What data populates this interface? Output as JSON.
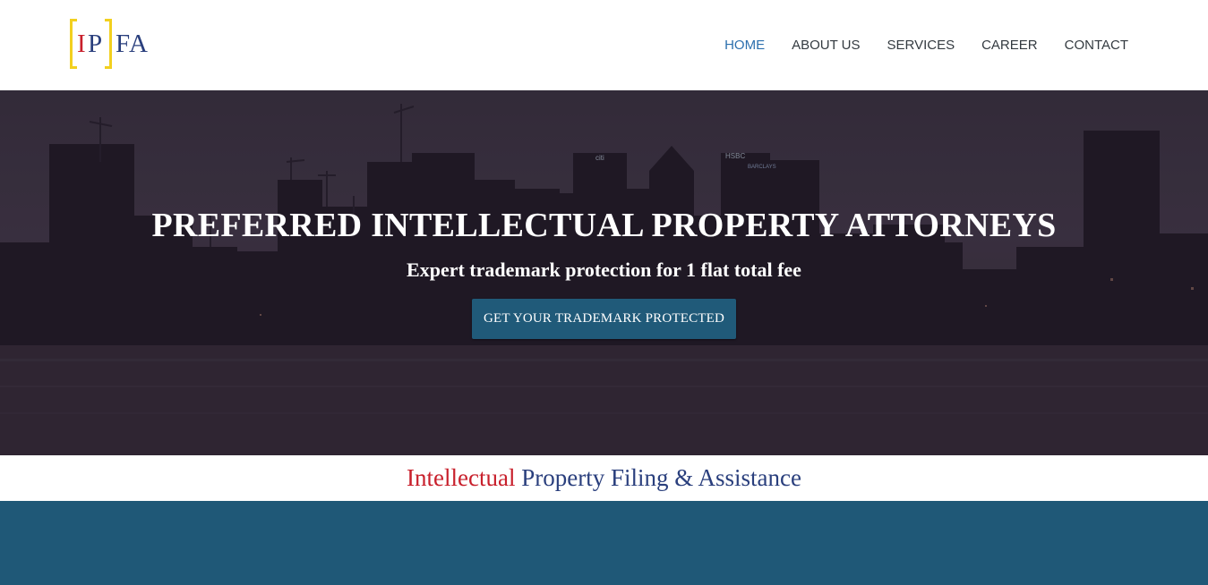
{
  "logo": {
    "letter_i": "I",
    "letter_p": "P",
    "letters_fa": "FA"
  },
  "nav": {
    "items": [
      {
        "label": "HOME",
        "active": true
      },
      {
        "label": "ABOUT US",
        "active": false
      },
      {
        "label": "SERVICES",
        "active": false
      },
      {
        "label": "CAREER",
        "active": false
      },
      {
        "label": "CONTACT",
        "active": false
      }
    ]
  },
  "hero": {
    "title": "PREFERRED INTELLECTUAL PROPERTY ATTORNEYS",
    "subtitle": "Expert trademark protection for 1 flat total fee",
    "cta_label": "GET YOUR TRADEMARK PROTECTED",
    "sign_hsbc": "HSBC",
    "sign_citi": "citi",
    "sign_barclays": "BARCLAYS"
  },
  "tagline": {
    "red_part": "Intellectual",
    "blue_part": "Property Filing & Assistance"
  },
  "colors": {
    "accent": "#2c6fae",
    "brand_red": "#c8202c",
    "brand_navy": "#2a3f7d",
    "logo_yellow": "#f2d01f",
    "cta_bg": "#205a79",
    "band_bg": "#1f5877"
  }
}
